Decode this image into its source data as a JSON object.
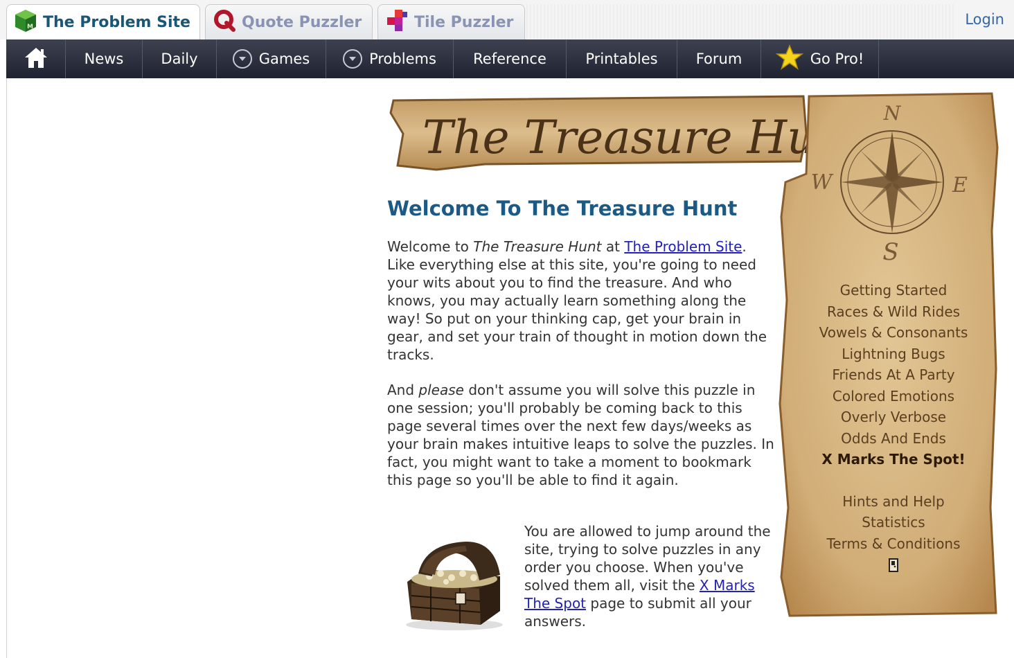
{
  "site_tabs": [
    {
      "label": "The Problem Site",
      "icon": "green-cube-icon",
      "active": true
    },
    {
      "label": "Quote Puzzler",
      "icon": "red-q-icon",
      "active": false
    },
    {
      "label": "Tile Puzzler",
      "icon": "tiles-icon",
      "active": false
    }
  ],
  "login_label": "Login",
  "nav": {
    "home_icon": "home-icon",
    "items": [
      "News",
      "Daily",
      "Games",
      "Problems",
      "Reference",
      "Printables",
      "Forum",
      "Go Pro!"
    ]
  },
  "banner_title": "The Treasure Hunt",
  "compass": {
    "n": "N",
    "s": "S",
    "e": "E",
    "w": "W"
  },
  "main": {
    "heading": "Welcome To The Treasure Hunt",
    "p1": {
      "t1": "Welcome to ",
      "em": "The Treasure Hunt",
      "t2": " at ",
      "link": "The Problem Site",
      "t3": ". Like everything else at this site, you're going to need your wits about you to find the treasure. And who knows, you may actually learn something along the way! So put on your thinking cap, get your brain in gear, and set your train of thought in motion down the tracks."
    },
    "p2": {
      "t1": "And ",
      "em": "please",
      "t2": " don't assume you will solve this puzzle in one session; you'll probably be coming back to this page several times over the next few days/weeks as your brain makes intuitive leaps to solve the puzzles. In fact, you might want to take a moment to bookmark this page so you'll be able to find it again."
    },
    "p3": {
      "t1": "You are allowed to jump around the site, trying to solve puzzles in any order you choose. When you've solved them all, visit the ",
      "link": "X Marks The Spot",
      "t2": " page to submit all your answers."
    }
  },
  "scroll_menu": {
    "items": [
      "Getting Started",
      "Races & Wild Rides",
      "Vowels & Consonants",
      "Lightning Bugs",
      "Friends At A Party",
      "Colored Emotions",
      "Overly Verbose",
      "Odds And Ends",
      "X Marks The Spot!"
    ],
    "secondary": [
      "Hints and Help",
      "Statistics",
      "Terms & Conditions"
    ]
  },
  "colors": {
    "nav_bg": "#2b2e3c",
    "heading": "#1a5a84",
    "link": "#2222bb",
    "parchment": "#d9b888"
  }
}
